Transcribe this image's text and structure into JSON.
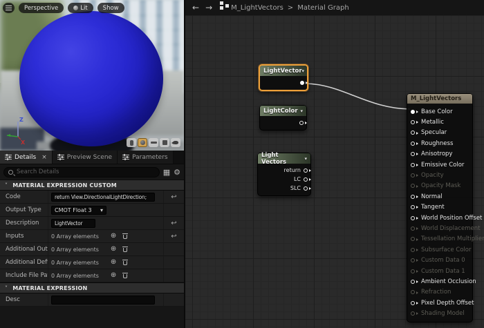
{
  "viewport": {
    "buttons": {
      "perspective": "Perspective",
      "lit": "Lit",
      "show": "Show"
    },
    "axis": {
      "x": "X",
      "y": "Y",
      "z": "Z"
    },
    "mesh_buttons": [
      "cylinder",
      "sphere",
      "plane",
      "cube",
      "teapot"
    ],
    "active_mesh": "sphere"
  },
  "breadcrumb": {
    "back": "←",
    "forward": "→",
    "root": "M_LightVectors",
    "sep": ">",
    "page": "Material Graph"
  },
  "details": {
    "tabs": [
      {
        "label": "Details",
        "active": true,
        "close": "×"
      },
      {
        "label": "Preview Scene",
        "active": false
      },
      {
        "label": "Parameters",
        "active": false
      }
    ],
    "search_placeholder": "Search Details",
    "icons": {
      "grid": "▦",
      "gear": "⚙",
      "chevron": "˅",
      "plus": "⊕",
      "reset": "↩",
      "select_chevron": "▾"
    },
    "sections": [
      {
        "title": "MATERIAL EXPRESSION CUSTOM",
        "rows": [
          {
            "label": "Code",
            "type": "input",
            "value": "return View.DirectionalLightDirection;"
          },
          {
            "label": "Output Type",
            "type": "select",
            "value": "CMOT Float 3"
          },
          {
            "label": "Description",
            "type": "input",
            "value": "LightVector"
          },
          {
            "label": "Inputs",
            "type": "array",
            "value": "0 Array elements"
          },
          {
            "label": "Additional Outputs",
            "type": "array",
            "value": "0 Array elements"
          },
          {
            "label": "Additional Defines",
            "type": "array",
            "value": "0 Array elements"
          },
          {
            "label": "Include File Paths",
            "type": "array",
            "value": "0 Array elements"
          }
        ]
      },
      {
        "title": "MATERIAL EXPRESSION",
        "rows": [
          {
            "label": "Desc",
            "type": "input",
            "value": ""
          }
        ]
      }
    ]
  },
  "graph": {
    "nodes": [
      {
        "title": "LightVector",
        "selected": true,
        "chevron": "▾",
        "outputs": [
          {
            "label": "",
            "state": "connected"
          }
        ]
      },
      {
        "title": "LightColor",
        "selected": false,
        "chevron": "▾",
        "outputs": [
          {
            "label": "",
            "state": "open"
          }
        ]
      },
      {
        "title": "Light Vectors",
        "selected": false,
        "chevron": "▾",
        "outputs": [
          {
            "label": "return",
            "state": "open"
          },
          {
            "label": "LC",
            "state": "open"
          },
          {
            "label": "SLC",
            "state": "open"
          }
        ]
      },
      {
        "title": "M_LightVectors",
        "type": "result",
        "inputs": [
          {
            "label": "Base Color",
            "state": "connected"
          },
          {
            "label": "Metallic",
            "state": "active"
          },
          {
            "label": "Specular",
            "state": "active"
          },
          {
            "label": "Roughness",
            "state": "active"
          },
          {
            "label": "Anisotropy",
            "state": "active"
          },
          {
            "label": "Emissive Color",
            "state": "active"
          },
          {
            "label": "Opacity",
            "state": "disabled"
          },
          {
            "label": "Opacity Mask",
            "state": "disabled"
          },
          {
            "label": "Normal",
            "state": "active"
          },
          {
            "label": "Tangent",
            "state": "active"
          },
          {
            "label": "World Position Offset",
            "state": "active"
          },
          {
            "label": "World Displacement",
            "state": "disabled"
          },
          {
            "label": "Tessellation Multiplier",
            "state": "disabled"
          },
          {
            "label": "Subsurface Color",
            "state": "disabled"
          },
          {
            "label": "Custom Data 0",
            "state": "disabled"
          },
          {
            "label": "Custom Data 1",
            "state": "disabled"
          },
          {
            "label": "Ambient Occlusion",
            "state": "active"
          },
          {
            "label": "Refraction",
            "state": "disabled"
          },
          {
            "label": "Pixel Depth Offset",
            "state": "active"
          },
          {
            "label": "Shading Model",
            "state": "disabled"
          }
        ]
      }
    ],
    "colors": {
      "selection": "#eda03a",
      "wire": "#d2d2d2",
      "node_header_green": "#5f7055",
      "result_header_tan": "#8e8372",
      "sphere_blue": "#2424c8"
    }
  }
}
